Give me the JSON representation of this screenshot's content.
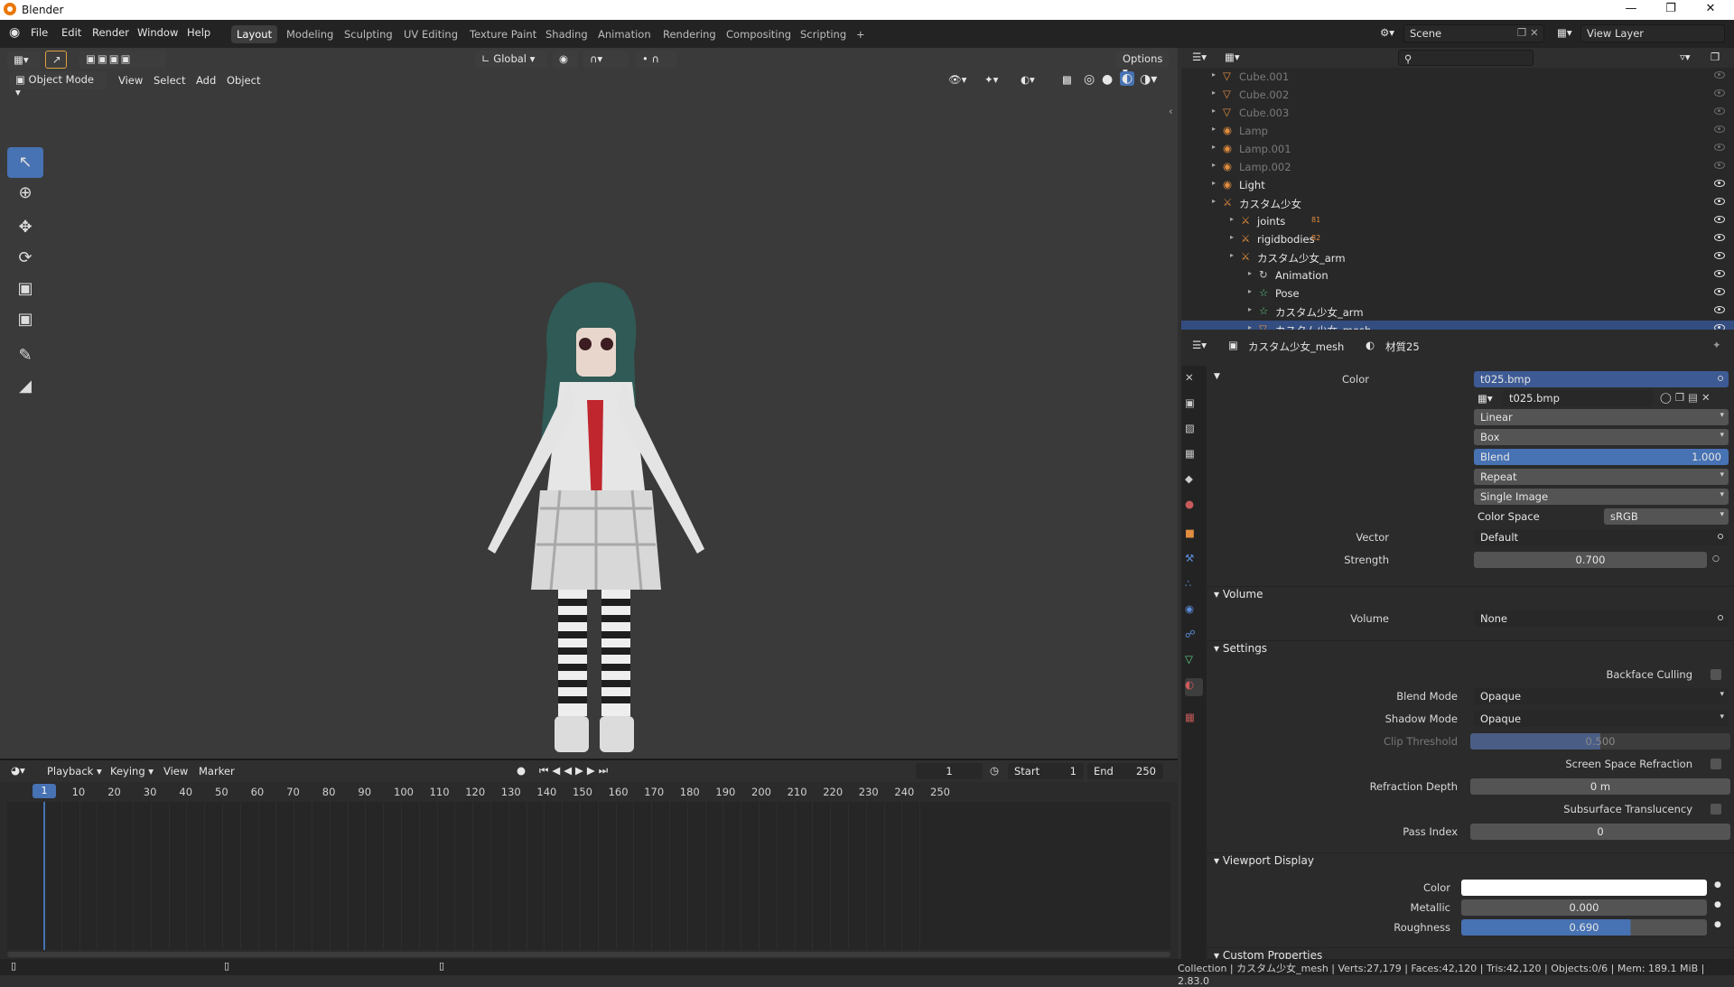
{
  "window": {
    "title": "Blender"
  },
  "menus": [
    "File",
    "Edit",
    "Render",
    "Window",
    "Help"
  ],
  "workspaces": [
    {
      "label": "Layout",
      "active": true
    },
    {
      "label": "Modeling"
    },
    {
      "label": "Sculpting"
    },
    {
      "label": "UV Editing"
    },
    {
      "label": "Texture Paint"
    },
    {
      "label": "Shading"
    },
    {
      "label": "Animation"
    },
    {
      "label": "Rendering"
    },
    {
      "label": "Compositing"
    },
    {
      "label": "Scripting"
    }
  ],
  "scene": {
    "name": "Scene",
    "view_layer": "View Layer"
  },
  "viewport": {
    "mode": "Object Mode",
    "menus": [
      "View",
      "Select",
      "Add",
      "Object"
    ],
    "orientation": "Global",
    "options": "Options"
  },
  "timeline": {
    "menus": [
      "Playback",
      "Keying",
      "View",
      "Marker"
    ],
    "current_frame": "1",
    "start_label": "Start",
    "start": "1",
    "end_label": "End",
    "end": "250",
    "ticks": [
      "10",
      "20",
      "30",
      "40",
      "50",
      "60",
      "70",
      "80",
      "90",
      "100",
      "110",
      "120",
      "130",
      "140",
      "150",
      "160",
      "170",
      "180",
      "190",
      "200",
      "210",
      "220",
      "230",
      "240",
      "250"
    ],
    "cursor_frame": "1"
  },
  "outliner": {
    "rows": [
      {
        "name": "Cube.001",
        "indent": 0,
        "dim": true,
        "icon": "mesh-icon"
      },
      {
        "name": "Cube.002",
        "indent": 0,
        "dim": true,
        "icon": "mesh-icon"
      },
      {
        "name": "Cube.003",
        "indent": 0,
        "dim": true,
        "icon": "mesh-icon"
      },
      {
        "name": "Lamp",
        "indent": 0,
        "dim": true,
        "icon": "light-icon"
      },
      {
        "name": "Lamp.001",
        "indent": 0,
        "dim": true,
        "icon": "light-icon"
      },
      {
        "name": "Lamp.002",
        "indent": 0,
        "dim": true,
        "icon": "light-icon"
      },
      {
        "name": "Light",
        "indent": 0,
        "dim": false,
        "icon": "light-icon"
      },
      {
        "name": "カスタム少女",
        "indent": 0,
        "dim": false,
        "icon": "empty-icon"
      },
      {
        "name": "joints",
        "indent": 1,
        "dim": false,
        "icon": "empty-icon",
        "badge": "81"
      },
      {
        "name": "rigidbodies",
        "indent": 1,
        "dim": false,
        "icon": "empty-icon",
        "badge": "82"
      },
      {
        "name": "カスタム少女_arm",
        "indent": 1,
        "dim": false,
        "icon": "armature-icon"
      },
      {
        "name": "Animation",
        "indent": 2,
        "dim": false,
        "icon": "animation-icon"
      },
      {
        "name": "Pose",
        "indent": 2,
        "dim": false,
        "icon": "pose-icon"
      },
      {
        "name": "カスタム少女_arm",
        "indent": 2,
        "dim": false,
        "icon": "armature-data-icon"
      },
      {
        "name": "カスタム少女_mesh",
        "indent": 2,
        "dim": false,
        "icon": "mesh-icon",
        "selected": true
      }
    ]
  },
  "properties": {
    "breadcrumb_object": "カスタム少女_mesh",
    "breadcrumb_material": "材質25",
    "color_label": "Color",
    "color_value": "t025.bmp",
    "image_name": "t025.bmp",
    "interpolation": "Linear",
    "projection": "Box",
    "blend_label": "Blend",
    "blend_value": "1.000",
    "extension": "Repeat",
    "source": "Single Image",
    "color_space_label": "Color Space",
    "color_space": "sRGB",
    "vector_label": "Vector",
    "vector_value": "Default",
    "strength_label": "Strength",
    "strength_value": "0.700",
    "volume_section": "Volume",
    "volume_label": "Volume",
    "volume_value": "None",
    "settings_section": "Settings",
    "backface_culling": "Backface Culling",
    "blend_mode_label": "Blend Mode",
    "blend_mode": "Opaque",
    "shadow_mode_label": "Shadow Mode",
    "shadow_mode": "Opaque",
    "clip_threshold_label": "Clip Threshold",
    "clip_threshold": "0.500",
    "ssr_label": "Screen Space Refraction",
    "refraction_depth_label": "Refraction Depth",
    "refraction_depth": "0 m",
    "sss_label": "Subsurface Translucency",
    "pass_index_label": "Pass Index",
    "pass_index": "0",
    "viewport_display_section": "Viewport Display",
    "vd_color_label": "Color",
    "metallic_label": "Metallic",
    "metallic": "0.000",
    "roughness_label": "Roughness",
    "roughness": "0.690",
    "custom_props_section": "Custom Properties"
  },
  "status": {
    "text": "Collection | カスタム少女_mesh | Verts:27,179 | Faces:42,120 | Tris:42,120 | Objects:0/6 | Mem: 189.1 MiB | 2.83.0"
  },
  "colors": {
    "accent": "#4772b3",
    "selection": "#334d80",
    "orange": "#e28d3f",
    "green": "#5fcf85"
  }
}
